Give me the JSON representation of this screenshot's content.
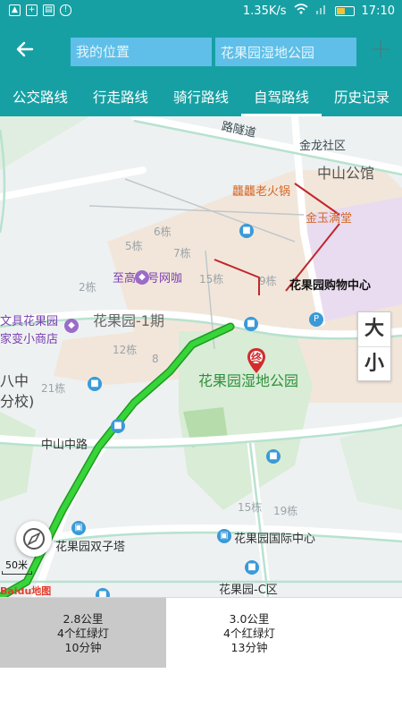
{
  "status_bar": {
    "speed": "1.35K/s",
    "time": "17:10"
  },
  "header": {
    "back_icon": "arrow-left-icon",
    "origin": {
      "value": "",
      "placeholder": "我的位置"
    },
    "destination": {
      "value": "花果园湿地公园",
      "placeholder": ""
    },
    "add_icon": "plus-icon"
  },
  "tabs": [
    {
      "label": "公交路线",
      "active": false
    },
    {
      "label": "行走路线",
      "active": false
    },
    {
      "label": "骑行路线",
      "active": false
    },
    {
      "label": "自驾路线",
      "active": true
    },
    {
      "label": "历史记录",
      "active": false
    }
  ],
  "map": {
    "labels": {
      "tunnel": "路隧道",
      "jinlong": "金龙社区",
      "zhongshan_gongguan": "中山公馆",
      "huohuo": "龘龘老火锅",
      "jinyu": "金玉满堂",
      "b5": "5栋",
      "b6": "6栋",
      "b7": "7栋",
      "b15a": "15栋",
      "b9": "9栋",
      "b2": "2栋",
      "zhigao": "至高壹号网咖",
      "mall": "花果园购物中心",
      "wenju": "文具花果园",
      "jiabian": "家变小商店",
      "phase1": "花果园-1期",
      "b12": "12栋",
      "b8": "8",
      "b21": "21栋",
      "park": "花果园湿地公园",
      "school_a": "八中",
      "school_b": "分校)",
      "zhongshan_road": "中山中路",
      "shuangzi": "花果园双子塔",
      "guoji": "花果园国际中心",
      "b15b": "15栋",
      "b19": "19栋",
      "c_area": "花果园-C区",
      "end_marker": "终"
    },
    "zoom_in": "大",
    "zoom_out": "小",
    "scale": "50米",
    "logo": "Baidu地图",
    "compass_icon": "compass-icon",
    "route_color": "#2ecc2e"
  },
  "routes": [
    {
      "distance": "2.8公里",
      "lights": "4个红绿灯",
      "time": "10分钟",
      "selected": true
    },
    {
      "distance": "3.0公里",
      "lights": "4个红绿灯",
      "time": "13分钟",
      "selected": false
    }
  ]
}
